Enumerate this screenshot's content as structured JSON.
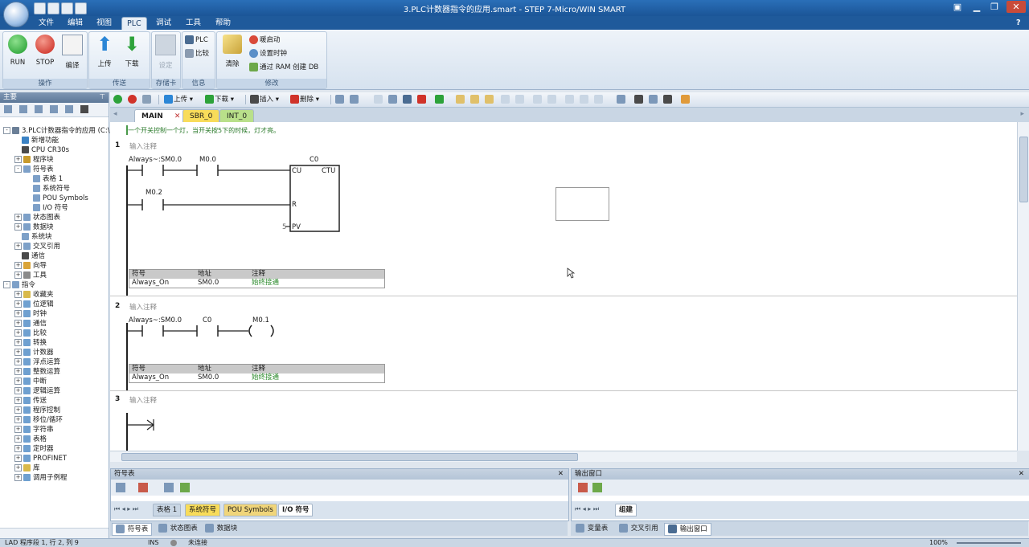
{
  "app": {
    "title": "3.PLC计数器指令的应用.smart - STEP 7-Micro/WIN SMART"
  },
  "menu": {
    "tabs": [
      "文件",
      "编辑",
      "视图",
      "PLC",
      "调试",
      "工具",
      "帮助"
    ],
    "active": "PLC"
  },
  "ribbon": {
    "run": "RUN",
    "stop": "STOP",
    "compile": "编译",
    "upload": "上传",
    "download": "下载",
    "set": "设定",
    "plc": "PLC",
    "compare": "比较",
    "clear": "清除",
    "warm_start": "暖启动",
    "set_clock": "设置时钟",
    "ram_db": "通过 RAM 创建 DB",
    "groups": [
      "操作",
      "传送",
      "存储卡",
      "信息",
      "修改"
    ]
  },
  "toolbar": {
    "upload": "上传",
    "download": "下载",
    "insert": "插入",
    "delete": "删除"
  },
  "tree": {
    "header": "主要",
    "items": [
      {
        "label": "3.PLC计数器指令的应用 (C:\\",
        "pm": "-",
        "indent": 0,
        "color": "#6b7f97"
      },
      {
        "label": "新增功能",
        "pm": "",
        "indent": 1,
        "color": "#3b82c4"
      },
      {
        "label": "CPU CR30s",
        "pm": "",
        "indent": 1,
        "color": "#4a4a4a"
      },
      {
        "label": "程序块",
        "pm": "+",
        "indent": 1,
        "color": "#c79a2c"
      },
      {
        "label": "符号表",
        "pm": "-",
        "indent": 1,
        "color": "#7da0c8"
      },
      {
        "label": "表格 1",
        "pm": "",
        "indent": 2,
        "color": "#7da0c8"
      },
      {
        "label": "系统符号",
        "pm": "",
        "indent": 2,
        "color": "#7da0c8"
      },
      {
        "label": "POU Symbols",
        "pm": "",
        "indent": 2,
        "color": "#7da0c8"
      },
      {
        "label": "I/O 符号",
        "pm": "",
        "indent": 2,
        "color": "#7da0c8"
      },
      {
        "label": "状态图表",
        "pm": "+",
        "indent": 1,
        "color": "#7da0c8"
      },
      {
        "label": "数据块",
        "pm": "+",
        "indent": 1,
        "color": "#7da0c8"
      },
      {
        "label": "系统块",
        "pm": "",
        "indent": 1,
        "color": "#7da0c8"
      },
      {
        "label": "交叉引用",
        "pm": "+",
        "indent": 1,
        "color": "#7da0c8"
      },
      {
        "label": "通信",
        "pm": "",
        "indent": 1,
        "color": "#4a4a4a"
      },
      {
        "label": "向导",
        "pm": "+",
        "indent": 1,
        "color": "#d9a43a"
      },
      {
        "label": "工具",
        "pm": "+",
        "indent": 1,
        "color": "#8a8a8a"
      },
      {
        "label": "指令",
        "pm": "-",
        "indent": 0,
        "color": "#7da0c8"
      },
      {
        "label": "收藏夹",
        "pm": "+",
        "indent": 1,
        "color": "#d9b94a"
      },
      {
        "label": "位逻辑",
        "pm": "+",
        "indent": 1,
        "color": "#6fa0d0"
      },
      {
        "label": "时钟",
        "pm": "+",
        "indent": 1,
        "color": "#6fa0d0"
      },
      {
        "label": "通信",
        "pm": "+",
        "indent": 1,
        "color": "#6fa0d0"
      },
      {
        "label": "比较",
        "pm": "+",
        "indent": 1,
        "color": "#6fa0d0"
      },
      {
        "label": "转换",
        "pm": "+",
        "indent": 1,
        "color": "#6fa0d0"
      },
      {
        "label": "计数器",
        "pm": "+",
        "indent": 1,
        "color": "#6fa0d0"
      },
      {
        "label": "浮点运算",
        "pm": "+",
        "indent": 1,
        "color": "#6fa0d0"
      },
      {
        "label": "整数运算",
        "pm": "+",
        "indent": 1,
        "color": "#6fa0d0"
      },
      {
        "label": "中断",
        "pm": "+",
        "indent": 1,
        "color": "#6fa0d0"
      },
      {
        "label": "逻辑运算",
        "pm": "+",
        "indent": 1,
        "color": "#6fa0d0"
      },
      {
        "label": "传送",
        "pm": "+",
        "indent": 1,
        "color": "#6fa0d0"
      },
      {
        "label": "程序控制",
        "pm": "+",
        "indent": 1,
        "color": "#6fa0d0"
      },
      {
        "label": "移位/循环",
        "pm": "+",
        "indent": 1,
        "color": "#6fa0d0"
      },
      {
        "label": "字符串",
        "pm": "+",
        "indent": 1,
        "color": "#6fa0d0"
      },
      {
        "label": "表格",
        "pm": "+",
        "indent": 1,
        "color": "#6fa0d0"
      },
      {
        "label": "定时器",
        "pm": "+",
        "indent": 1,
        "color": "#6fa0d0"
      },
      {
        "label": "PROFINET",
        "pm": "+",
        "indent": 1,
        "color": "#6fa0d0"
      },
      {
        "label": "库",
        "pm": "+",
        "indent": 1,
        "color": "#d9b94a"
      },
      {
        "label": "调用子例程",
        "pm": "+",
        "indent": 1,
        "color": "#6fa0d0"
      }
    ]
  },
  "editor": {
    "tabs": [
      "MAIN",
      "SBR_0",
      "INT_0"
    ],
    "program_comment": "一个开关控制一个灯，当开关按5下的时候，灯才亮。",
    "network_comment_placeholder": "输入注释",
    "networks": [
      {
        "number": "1",
        "contacts": [
          "Always~:SM0.0",
          "M0.0",
          "M0.2"
        ],
        "box": {
          "name": "C0",
          "type": "CTU",
          "inputs": [
            "CU",
            "R",
            "PV"
          ],
          "pv_value": "5"
        },
        "symbols": {
          "headers": [
            "符号",
            "地址",
            "注释"
          ],
          "rows": [
            [
              "Always_On",
              "SM0.0",
              "始终接通"
            ]
          ]
        }
      },
      {
        "number": "2",
        "contacts": [
          "Always~:SM0.0",
          "C0"
        ],
        "coil": "M0.1",
        "symbols": {
          "headers": [
            "符号",
            "地址",
            "注释"
          ],
          "rows": [
            [
              "Always_On",
              "SM0.0",
              "始终接通"
            ]
          ]
        }
      },
      {
        "number": "3"
      }
    ]
  },
  "symbol_panel": {
    "title": "符号表",
    "tabs": [
      "表格 1",
      "系统符号",
      "POU Symbols",
      "I/O 符号"
    ]
  },
  "output_panel": {
    "title": "输出窗口",
    "tabs": [
      "组建"
    ]
  },
  "bottom_tabs_left": [
    "符号表",
    "状态图表",
    "数据块"
  ],
  "bottom_tabs_right": [
    "变量表",
    "交叉引用",
    "输出窗口"
  ],
  "status": {
    "position": "LAD 程序段 1, 行 2, 列 9",
    "mode": "INS",
    "connection": "未连接",
    "zoom": "100%"
  }
}
